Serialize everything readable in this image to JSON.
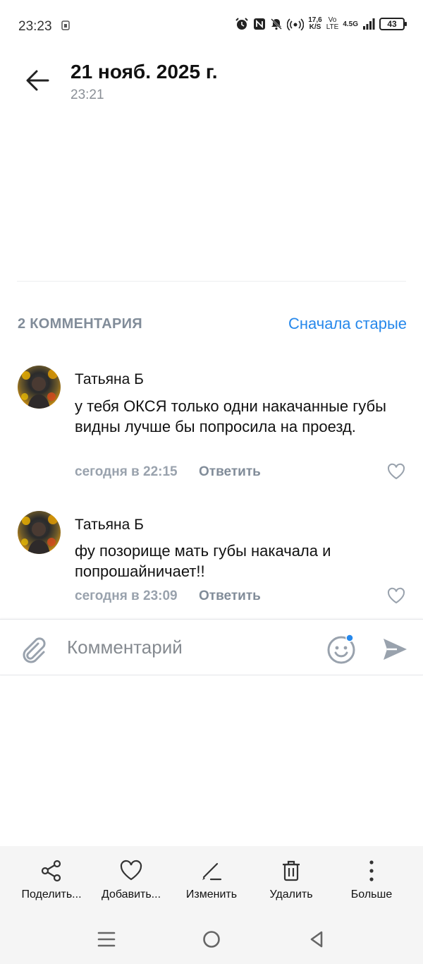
{
  "status_bar": {
    "time": "23:23",
    "speed_value": "17,6",
    "speed_unit": "K/S",
    "volte_top": "Vo",
    "volte_bottom": "LTE",
    "network": "4.5G",
    "battery": "43"
  },
  "header": {
    "title": "21 нояб. 2025 г.",
    "subtitle": "23:21"
  },
  "comments_section": {
    "count_label": "2 КОММЕНТАРИЯ",
    "sort_label": "Сначала старые",
    "comments": [
      {
        "author": "Татьяна Б",
        "text": "у тебя ОКСЯ только одни накачанные губы видны лучше бы попросила на проезд.",
        "time": "сегодня в 22:15",
        "reply_label": "Ответить"
      },
      {
        "author": "Татьяна Б",
        "text": "фу позорище мать губы накачала и попрошайничает!!",
        "time": "сегодня в 23:09",
        "reply_label": "Ответить"
      }
    ]
  },
  "comment_input": {
    "placeholder": "Комментарий"
  },
  "toolbar": {
    "items": [
      {
        "label": "Поделить...",
        "icon": "share-icon"
      },
      {
        "label": "Добавить...",
        "icon": "heart-icon"
      },
      {
        "label": "Изменить",
        "icon": "edit-icon"
      },
      {
        "label": "Удалить",
        "icon": "trash-icon"
      },
      {
        "label": "Больше",
        "icon": "more-icon"
      }
    ]
  },
  "colors": {
    "accent": "#2688eb",
    "muted": "#818c99",
    "toolbar_bg": "#f5f5f5"
  }
}
